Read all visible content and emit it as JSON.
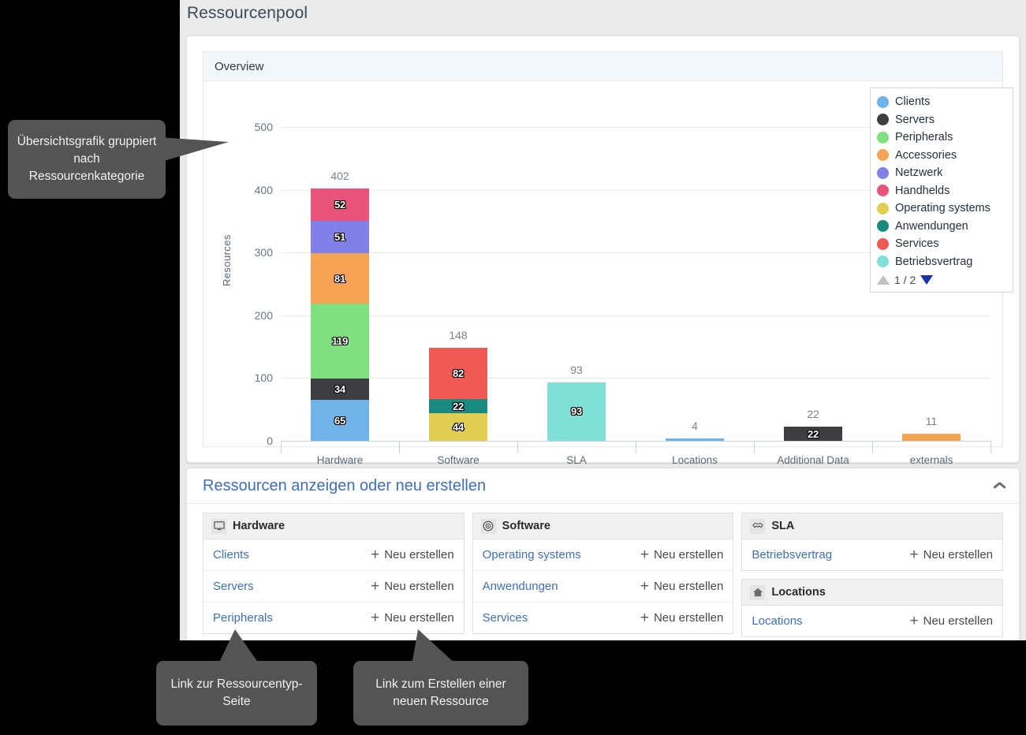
{
  "window": {
    "title": "Ressourcenpool"
  },
  "chart_panel": {
    "header": "Overview"
  },
  "chart_data": {
    "type": "bar",
    "stacked": true,
    "title": "Overview",
    "xlabel": "",
    "ylabel": "Resources",
    "ylim": [
      0,
      500
    ],
    "yticks": [
      0,
      100,
      200,
      300,
      400,
      500
    ],
    "grid": true,
    "legend_position": "top-right",
    "categories": [
      "Hardware",
      "Software",
      "SLA",
      "Locations",
      "Additional Data",
      "externals"
    ],
    "totals": [
      402,
      148,
      93,
      4,
      22,
      11
    ],
    "series": [
      {
        "name": "Clients",
        "color": "#6fb3e8",
        "values": [
          65,
          0,
          0,
          4,
          0,
          0
        ]
      },
      {
        "name": "Servers",
        "color": "#3e3e42",
        "values": [
          34,
          0,
          0,
          0,
          22,
          0
        ]
      },
      {
        "name": "Peripherals",
        "color": "#80e080",
        "values": [
          119,
          0,
          0,
          0,
          0,
          0
        ]
      },
      {
        "name": "Accessories",
        "color": "#f5a455",
        "values": [
          81,
          0,
          0,
          0,
          0,
          11
        ]
      },
      {
        "name": "Netzwerk",
        "color": "#8080e8",
        "values": [
          51,
          0,
          0,
          0,
          0,
          0
        ]
      },
      {
        "name": "Handhelds",
        "color": "#e8537a",
        "values": [
          52,
          0,
          0,
          0,
          0,
          0
        ]
      },
      {
        "name": "Operating systems",
        "color": "#e0cf52",
        "values": [
          0,
          44,
          0,
          0,
          0,
          0
        ]
      },
      {
        "name": "Anwendungen",
        "color": "#1a8a80",
        "values": [
          0,
          22,
          0,
          0,
          0,
          0
        ]
      },
      {
        "name": "Services",
        "color": "#f05a54",
        "values": [
          0,
          82,
          0,
          0,
          0,
          0
        ]
      },
      {
        "name": "Betriebsvertrag",
        "color": "#80e0d8",
        "values": [
          0,
          0,
          93,
          0,
          0,
          0
        ]
      }
    ]
  },
  "legend": {
    "entries": [
      {
        "label": "Clients",
        "color": "#6fb3e8"
      },
      {
        "label": "Servers",
        "color": "#3e3e42"
      },
      {
        "label": "Peripherals",
        "color": "#80e080"
      },
      {
        "label": "Accessories",
        "color": "#f5a455"
      },
      {
        "label": "Netzwerk",
        "color": "#8080e8"
      },
      {
        "label": "Handhelds",
        "color": "#e8537a"
      },
      {
        "label": "Operating systems",
        "color": "#e0cf52"
      },
      {
        "label": "Anwendungen",
        "color": "#1a8a80"
      },
      {
        "label": "Services",
        "color": "#f05a54"
      },
      {
        "label": "Betriebsvertrag",
        "color": "#80e0d8"
      }
    ],
    "pager": {
      "page_label": "1 / 2",
      "up_icon": "triangle-up-icon",
      "down_icon": "triangle-down-icon"
    }
  },
  "list_panel": {
    "title": "Ressourcen anzeigen oder neu erstellen",
    "collapse_icon": "chevron-up-icon",
    "new_label": "Neu erstellen",
    "groups": [
      {
        "name": "Hardware",
        "icon": "monitor-icon",
        "items": [
          "Clients",
          "Servers",
          "Peripherals"
        ]
      },
      {
        "name": "Software",
        "icon": "disc-icon",
        "items": [
          "Operating systems",
          "Anwendungen",
          "Services"
        ]
      },
      {
        "name": "SLA",
        "icon": "handshake-icon",
        "items": [
          "Betriebsvertrag"
        ]
      },
      {
        "name": "Locations",
        "icon": "home-icon",
        "items": [
          "Locations"
        ]
      }
    ]
  },
  "callouts": [
    {
      "text": "Übersichtsgrafik gruppiert nach Ressourcenkategorie"
    },
    {
      "text": "Link zur Ressourcentyp-Seite"
    },
    {
      "text": "Link zum Erstellen einer neuen Ressource"
    }
  ]
}
